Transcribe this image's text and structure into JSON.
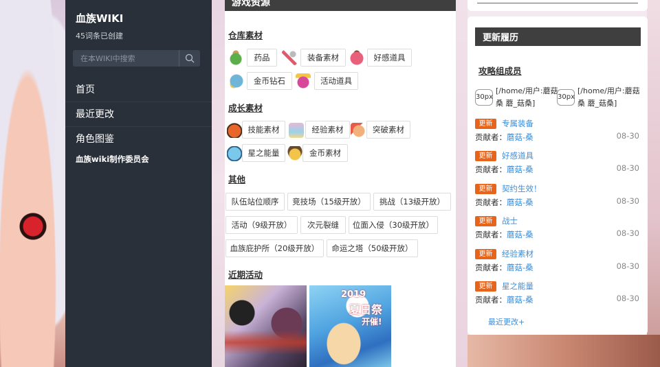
{
  "sidebar": {
    "title": "血族WIKI",
    "count": "45词条已创建",
    "search_placeholder": "在本WIKI中搜索",
    "nav": [
      "首页",
      "最近更改",
      "角色图鉴"
    ],
    "sub_link": "血族wiki制作委员会"
  },
  "main": {
    "header": "游戏资源",
    "sections": {
      "warehouse": "仓库素材",
      "growth": "成长素材",
      "other": "其他",
      "recent": "近期活动"
    },
    "warehouse_items": [
      "药品",
      "装备素材",
      "好感道具",
      "金币钻石",
      "活动道具"
    ],
    "growth_items": [
      "技能素材",
      "经验素材",
      "突破素材",
      "星之能量",
      "金币素材"
    ],
    "other_items": [
      "队伍站位顺序",
      "竞技场（15级开放）",
      "挑战（13级开放）",
      "活动（9级开放）",
      "次元裂缝",
      "位面入侵（30级开放）",
      "血族庇护所（20级开放）",
      "命运之塔（50级开放）"
    ],
    "banner_texts": [
      "2019",
      "夏日祭",
      "开催!"
    ]
  },
  "right": {
    "header": "更新履历",
    "group_title": "攻略组成员",
    "members": [
      {
        "avatar": "30px",
        "text": "[/home/用户:蘑菇桑 蘑_菇桑]"
      },
      {
        "avatar": "30px",
        "text": "[/home/用户:蘑菇桑 蘑_菇桑]"
      }
    ],
    "badge": "更新",
    "by_label": "贡献者：",
    "updates": [
      {
        "title": "专属装备",
        "author": "蘑菇-桑",
        "date": "08-30"
      },
      {
        "title": "好感道具",
        "author": "蘑菇-桑",
        "date": "08-30"
      },
      {
        "title": "契约生效！",
        "author": "蘑菇-桑",
        "date": "08-30"
      },
      {
        "title": "战士",
        "author": "蘑菇-桑",
        "date": "08-30"
      },
      {
        "title": "经验素材",
        "author": "蘑菇-桑",
        "date": "08-30"
      },
      {
        "title": "星之能量",
        "author": "蘑菇-桑",
        "date": "08-30"
      }
    ],
    "more": "最近更改+"
  },
  "colors": {
    "sidebar_bg": "#29303a",
    "header_bg": "#3f3f3f",
    "badge": "#e8641a",
    "link": "#3f8ed8"
  }
}
